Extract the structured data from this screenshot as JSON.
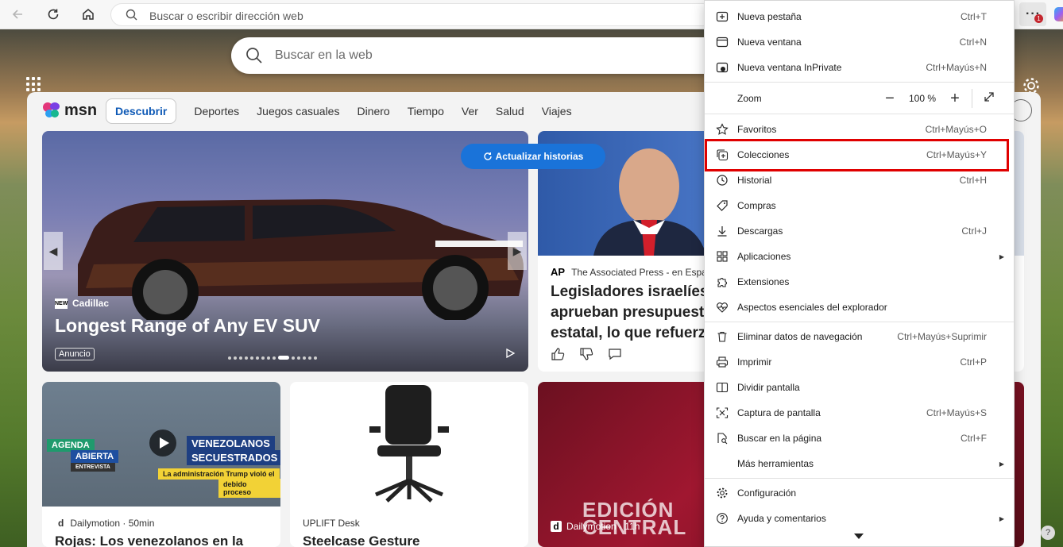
{
  "toolbar": {
    "address_placeholder": "Buscar o escribir dirección web",
    "notification_count": "1"
  },
  "page": {
    "search_placeholder": "Buscar en la web"
  },
  "feed": {
    "logo_text": "msn",
    "nav_tabs": [
      "Descubrir",
      "Deportes",
      "Juegos casuales",
      "Dinero",
      "Tiempo",
      "Ver",
      "Salud",
      "Viajes"
    ],
    "refresh_label": "Actualizar historias",
    "hero": {
      "brand": "Cadillac",
      "brand_logo": "NEW",
      "headline": "Longest Range of Any EV SUV",
      "ad_label": "Anuncio",
      "carousel_total": 15,
      "carousel_active": 9
    },
    "news": {
      "source_logo": "AP",
      "source": "The Associated Press - en Españ",
      "title": "Legisladores israelíes aprueban presupuest estatal, lo que refuerz"
    },
    "card1": {
      "tag1": "AGENDA",
      "tag2": "ABIERTA",
      "tag3": "ENTREVISTA",
      "overlay1": "VENEZOLANOS",
      "overlay2": "SECUESTRADOS",
      "caption1": "La administración Trump violó el",
      "caption2": "debido proceso",
      "source_logo": "d",
      "meta": "Dailymotion · 50min",
      "title": "Rojas: Los venezolanos en la"
    },
    "card2": {
      "meta": "UPLIFT Desk",
      "title": "Steelcase Gesture"
    },
    "card3": {
      "big1": "EDICIÓN",
      "big2": "CENTRAL",
      "source_logo": "d",
      "meta": "Dailymotion · 11h"
    }
  },
  "menu": {
    "items": [
      {
        "label": "Nueva pestaña",
        "shortcut": "Ctrl+T"
      },
      {
        "label": "Nueva ventana",
        "shortcut": "Ctrl+N"
      },
      {
        "label": "Nueva ventana InPrivate",
        "shortcut": "Ctrl+Mayús+N"
      },
      {
        "label": "Zoom",
        "shortcut": "",
        "zoom_value": "100 %"
      },
      {
        "label": "Favoritos",
        "shortcut": "Ctrl+Mayús+O"
      },
      {
        "label": "Colecciones",
        "shortcut": "Ctrl+Mayús+Y"
      },
      {
        "label": "Historial",
        "shortcut": "Ctrl+H"
      },
      {
        "label": "Compras",
        "shortcut": ""
      },
      {
        "label": "Descargas",
        "shortcut": "Ctrl+J"
      },
      {
        "label": "Aplicaciones",
        "shortcut": ""
      },
      {
        "label": "Extensiones",
        "shortcut": ""
      },
      {
        "label": "Aspectos esenciales del explorador",
        "shortcut": ""
      },
      {
        "label": "Eliminar datos de navegación",
        "shortcut": "Ctrl+Mayús+Suprimir"
      },
      {
        "label": "Imprimir",
        "shortcut": "Ctrl+P"
      },
      {
        "label": "Dividir pantalla",
        "shortcut": ""
      },
      {
        "label": "Captura de pantalla",
        "shortcut": "Ctrl+Mayús+S"
      },
      {
        "label": "Buscar en la página",
        "shortcut": "Ctrl+F"
      },
      {
        "label": "Más herramientas",
        "shortcut": ""
      },
      {
        "label": "Configuración",
        "shortcut": ""
      },
      {
        "label": "Ayuda y comentarios",
        "shortcut": ""
      }
    ],
    "highlight_color": "#e00000"
  },
  "help_label": "?"
}
